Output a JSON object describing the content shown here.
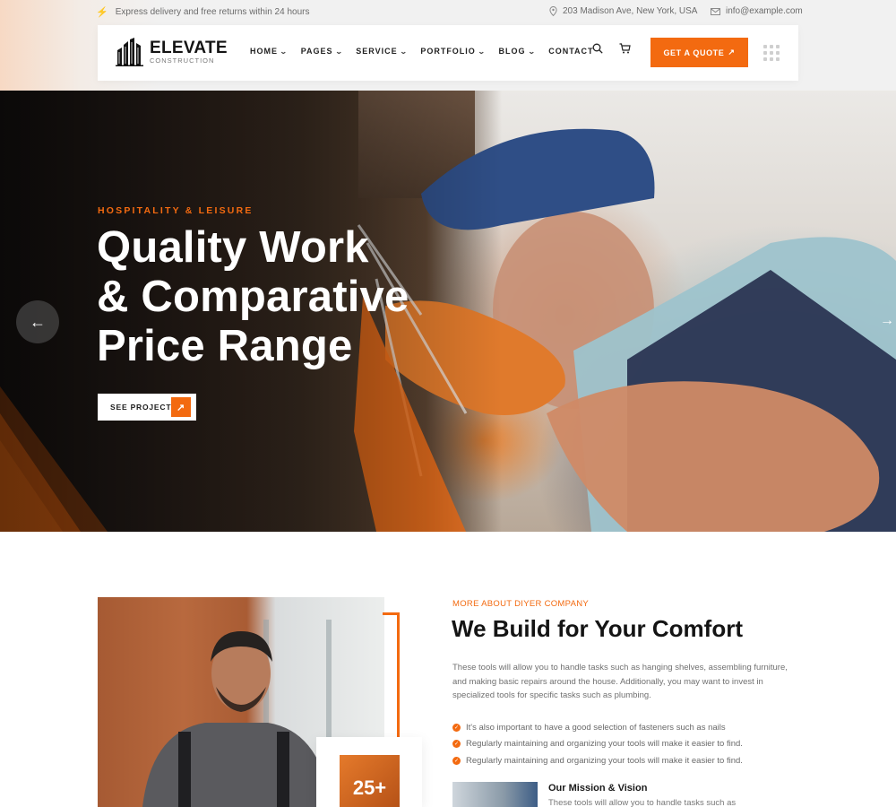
{
  "topbar": {
    "promo": "Express delivery and free returns within 24 hours",
    "address": "203 Madison Ave, New York, USA",
    "email": "info@example.com"
  },
  "brand": {
    "name": "ELEVATE",
    "tagline": "CONSTRUCTION"
  },
  "nav": {
    "items": [
      {
        "label": "HOME"
      },
      {
        "label": "PAGES"
      },
      {
        "label": "SERVICE"
      },
      {
        "label": "PORTFOLIO"
      },
      {
        "label": "BLOG"
      },
      {
        "label": "CONTACT"
      }
    ],
    "quote_label": "GET A QUOTE"
  },
  "hero": {
    "eyebrow": "HOSPITALITY & LEISURE",
    "title_lines": [
      "Quality Work",
      "& Comparative",
      "Price Range"
    ],
    "cta": "SEE PROJECT"
  },
  "about": {
    "eyebrow": "MORE ABOUT DIYER COMPANY",
    "title": "We Build for Your Comfort",
    "description": "These tools will allow you to handle tasks such as hanging shelves, assembling furniture, and making basic repairs around the house. Additionally, you may want to invest in specialized tools for specific tasks such as plumbing.",
    "checks": [
      "It's also important to have a good selection of fasteners such as nails",
      "Regularly maintaining and organizing your tools will make it easier to find.",
      "Regularly maintaining and organizing your tools will make it easier to find."
    ],
    "stat": "25+",
    "mission_title": "Our Mission & Vision",
    "mission_desc": "These tools will allow you to handle tasks such as"
  },
  "colors": {
    "accent": "#f36a10",
    "dark": "#141414"
  }
}
